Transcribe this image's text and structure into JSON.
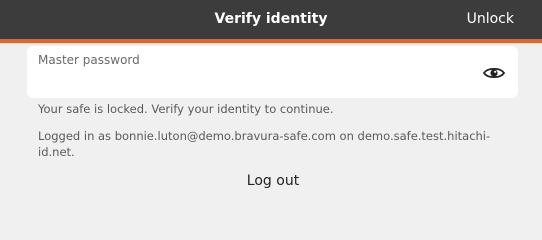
{
  "header": {
    "title": "Verify identity",
    "unlock_label": "Unlock",
    "background_color": "#3c3c3c",
    "accent_color": "#e8632b"
  },
  "password_field": {
    "label": "Master password",
    "value": "",
    "toggle_icon": "eye-icon"
  },
  "messages": {
    "locked": "Your safe is locked. Verify your identity to continue.",
    "logged_in": "Logged in as bonnie.luton@demo.bravura-safe.com on demo.safe.test.hitachi-id.net."
  },
  "actions": {
    "logout_label": "Log out"
  }
}
